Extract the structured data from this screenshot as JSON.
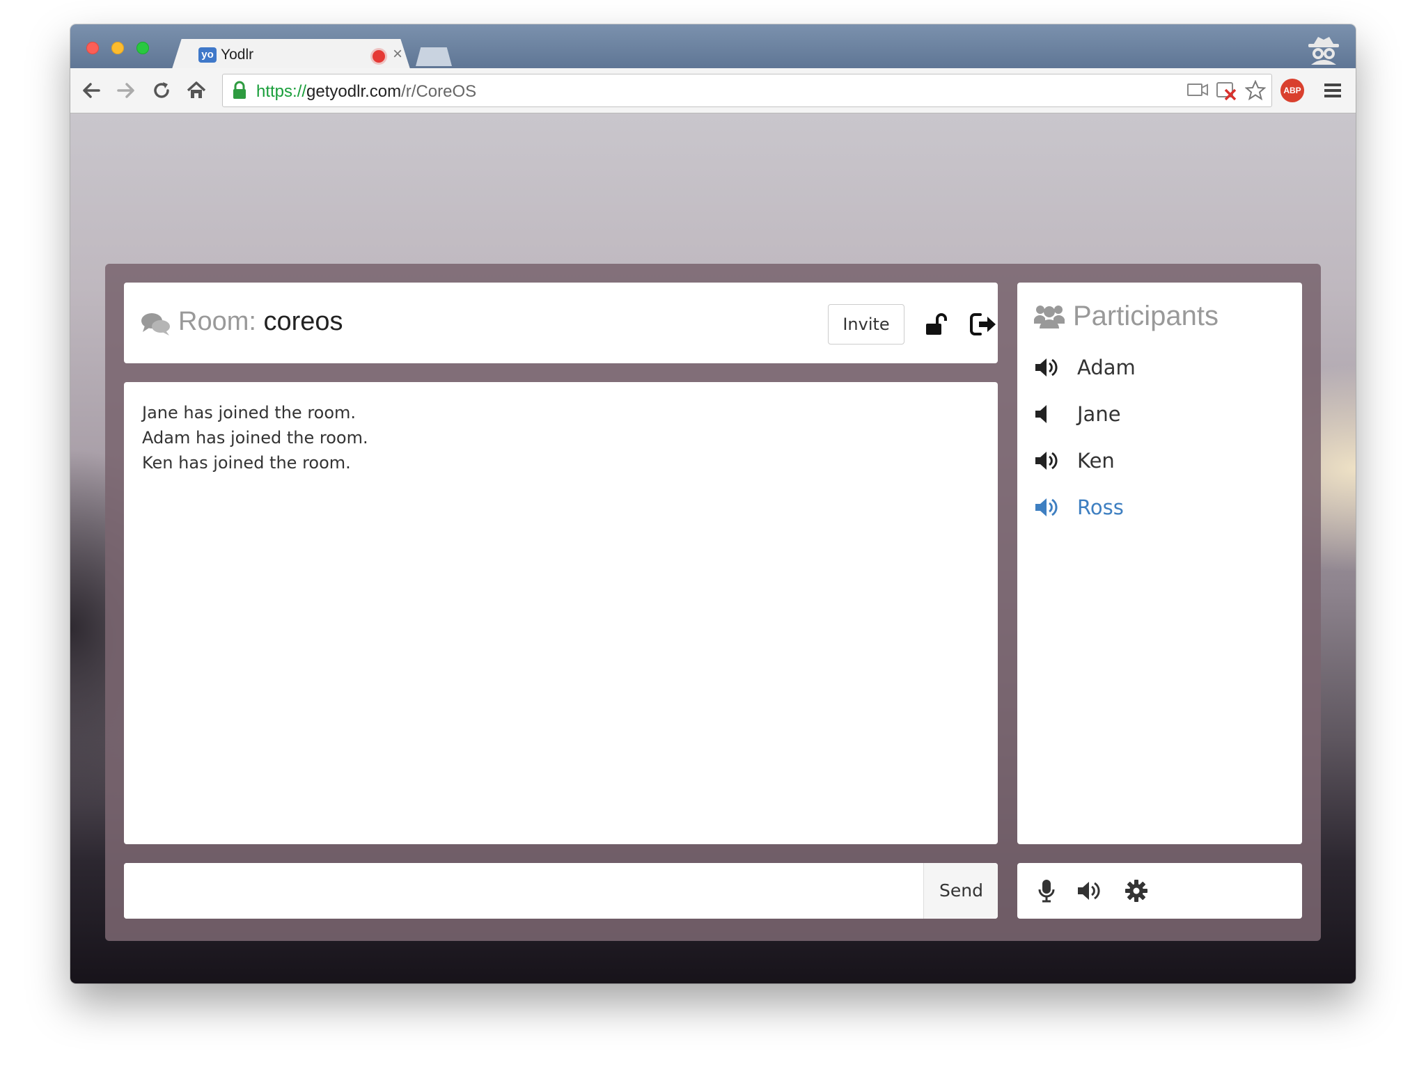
{
  "browser": {
    "tab": {
      "favicon_text": "yo",
      "title": "Yodlr",
      "close_label": "×"
    },
    "url": {
      "scheme": "https://",
      "host": "getyodlr.com",
      "path": "/r/CoreOS"
    },
    "extension_label": "ABP"
  },
  "room": {
    "label": "Room:",
    "name": "coreos",
    "invite_label": "Invite"
  },
  "chat": {
    "messages": [
      "Jane has joined the room.",
      "Adam has joined the room.",
      "Ken has joined the room."
    ],
    "input_value": "",
    "send_label": "Send"
  },
  "participants": {
    "title": "Participants",
    "list": [
      {
        "name": "Adam",
        "audio": "speaking"
      },
      {
        "name": "Jane",
        "audio": "quiet"
      },
      {
        "name": "Ken",
        "audio": "speaking"
      },
      {
        "name": "Ross",
        "audio": "speaking",
        "is_self": true
      }
    ]
  },
  "colors": {
    "self_accent": "#3e7fc1",
    "muted_text": "#999999",
    "app_frame": "#7a6570"
  }
}
